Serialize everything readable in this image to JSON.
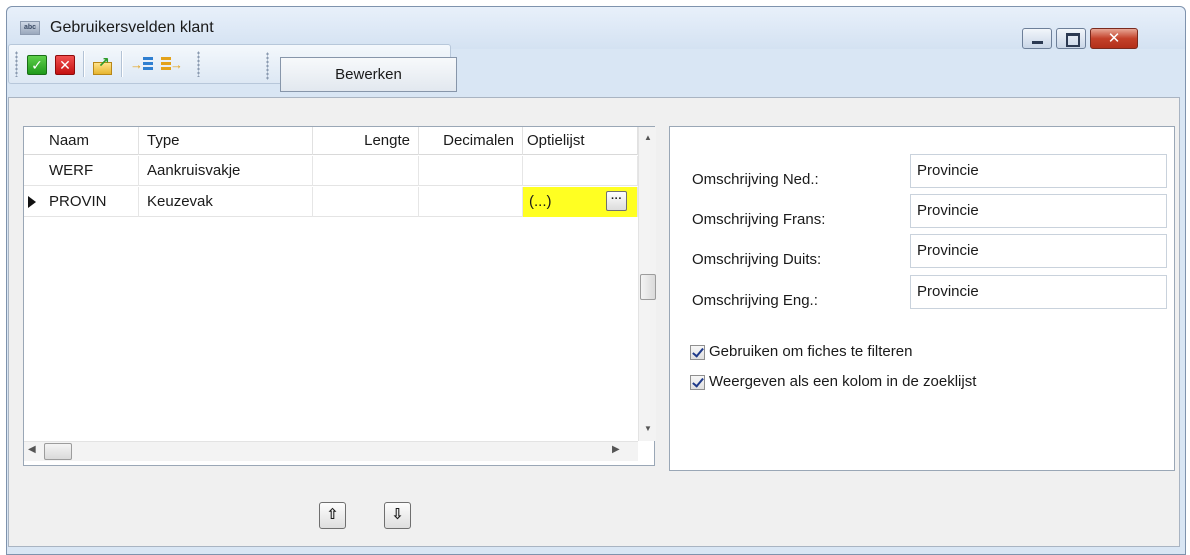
{
  "window": {
    "title": "Gebruikersvelden klant",
    "close_label": "✕"
  },
  "toolbar": {
    "ok_label": "✓",
    "cancel_label": "✕",
    "export_arrow": "↗",
    "insert_arrow": "→",
    "append_arrow": "→",
    "edit_label": "Bewerken"
  },
  "grid": {
    "columns": [
      "Naam",
      "Type",
      "Lengte",
      "Decimalen",
      "Optielijst"
    ],
    "rows": [
      {
        "naam": "WERF",
        "type": "Aankruisvakje",
        "lengte": "",
        "decimalen": "",
        "optielijst": ""
      },
      {
        "naam": "PROVIN",
        "type": "Keuzevak",
        "lengte": "",
        "decimalen": "",
        "optielijst": "(...)"
      }
    ],
    "ellipsis_label": "···",
    "highlight_color": "#ffff22"
  },
  "props": {
    "fields": [
      {
        "label": "Omschrijving Ned.:",
        "value": "Provincie"
      },
      {
        "label": "Omschrijving Frans:",
        "value": "Provincie"
      },
      {
        "label": "Omschrijving Duits:",
        "value": "Provincie"
      },
      {
        "label": "Omschrijving Eng.:",
        "value": "Provincie"
      }
    ],
    "checkboxes": [
      {
        "label": "Gebruiken om fiches te filteren",
        "checked": true
      },
      {
        "label": "Weergeven als een kolom in de zoeklijst",
        "checked": true
      }
    ]
  },
  "nav": {
    "up_label": "⇧",
    "down_label": "⇩"
  },
  "colors": {
    "window_bg": "#d9e6f4",
    "close_button": "#c3412a",
    "ok_green": "#1f9a1b",
    "cancel_red": "#c41111"
  }
}
